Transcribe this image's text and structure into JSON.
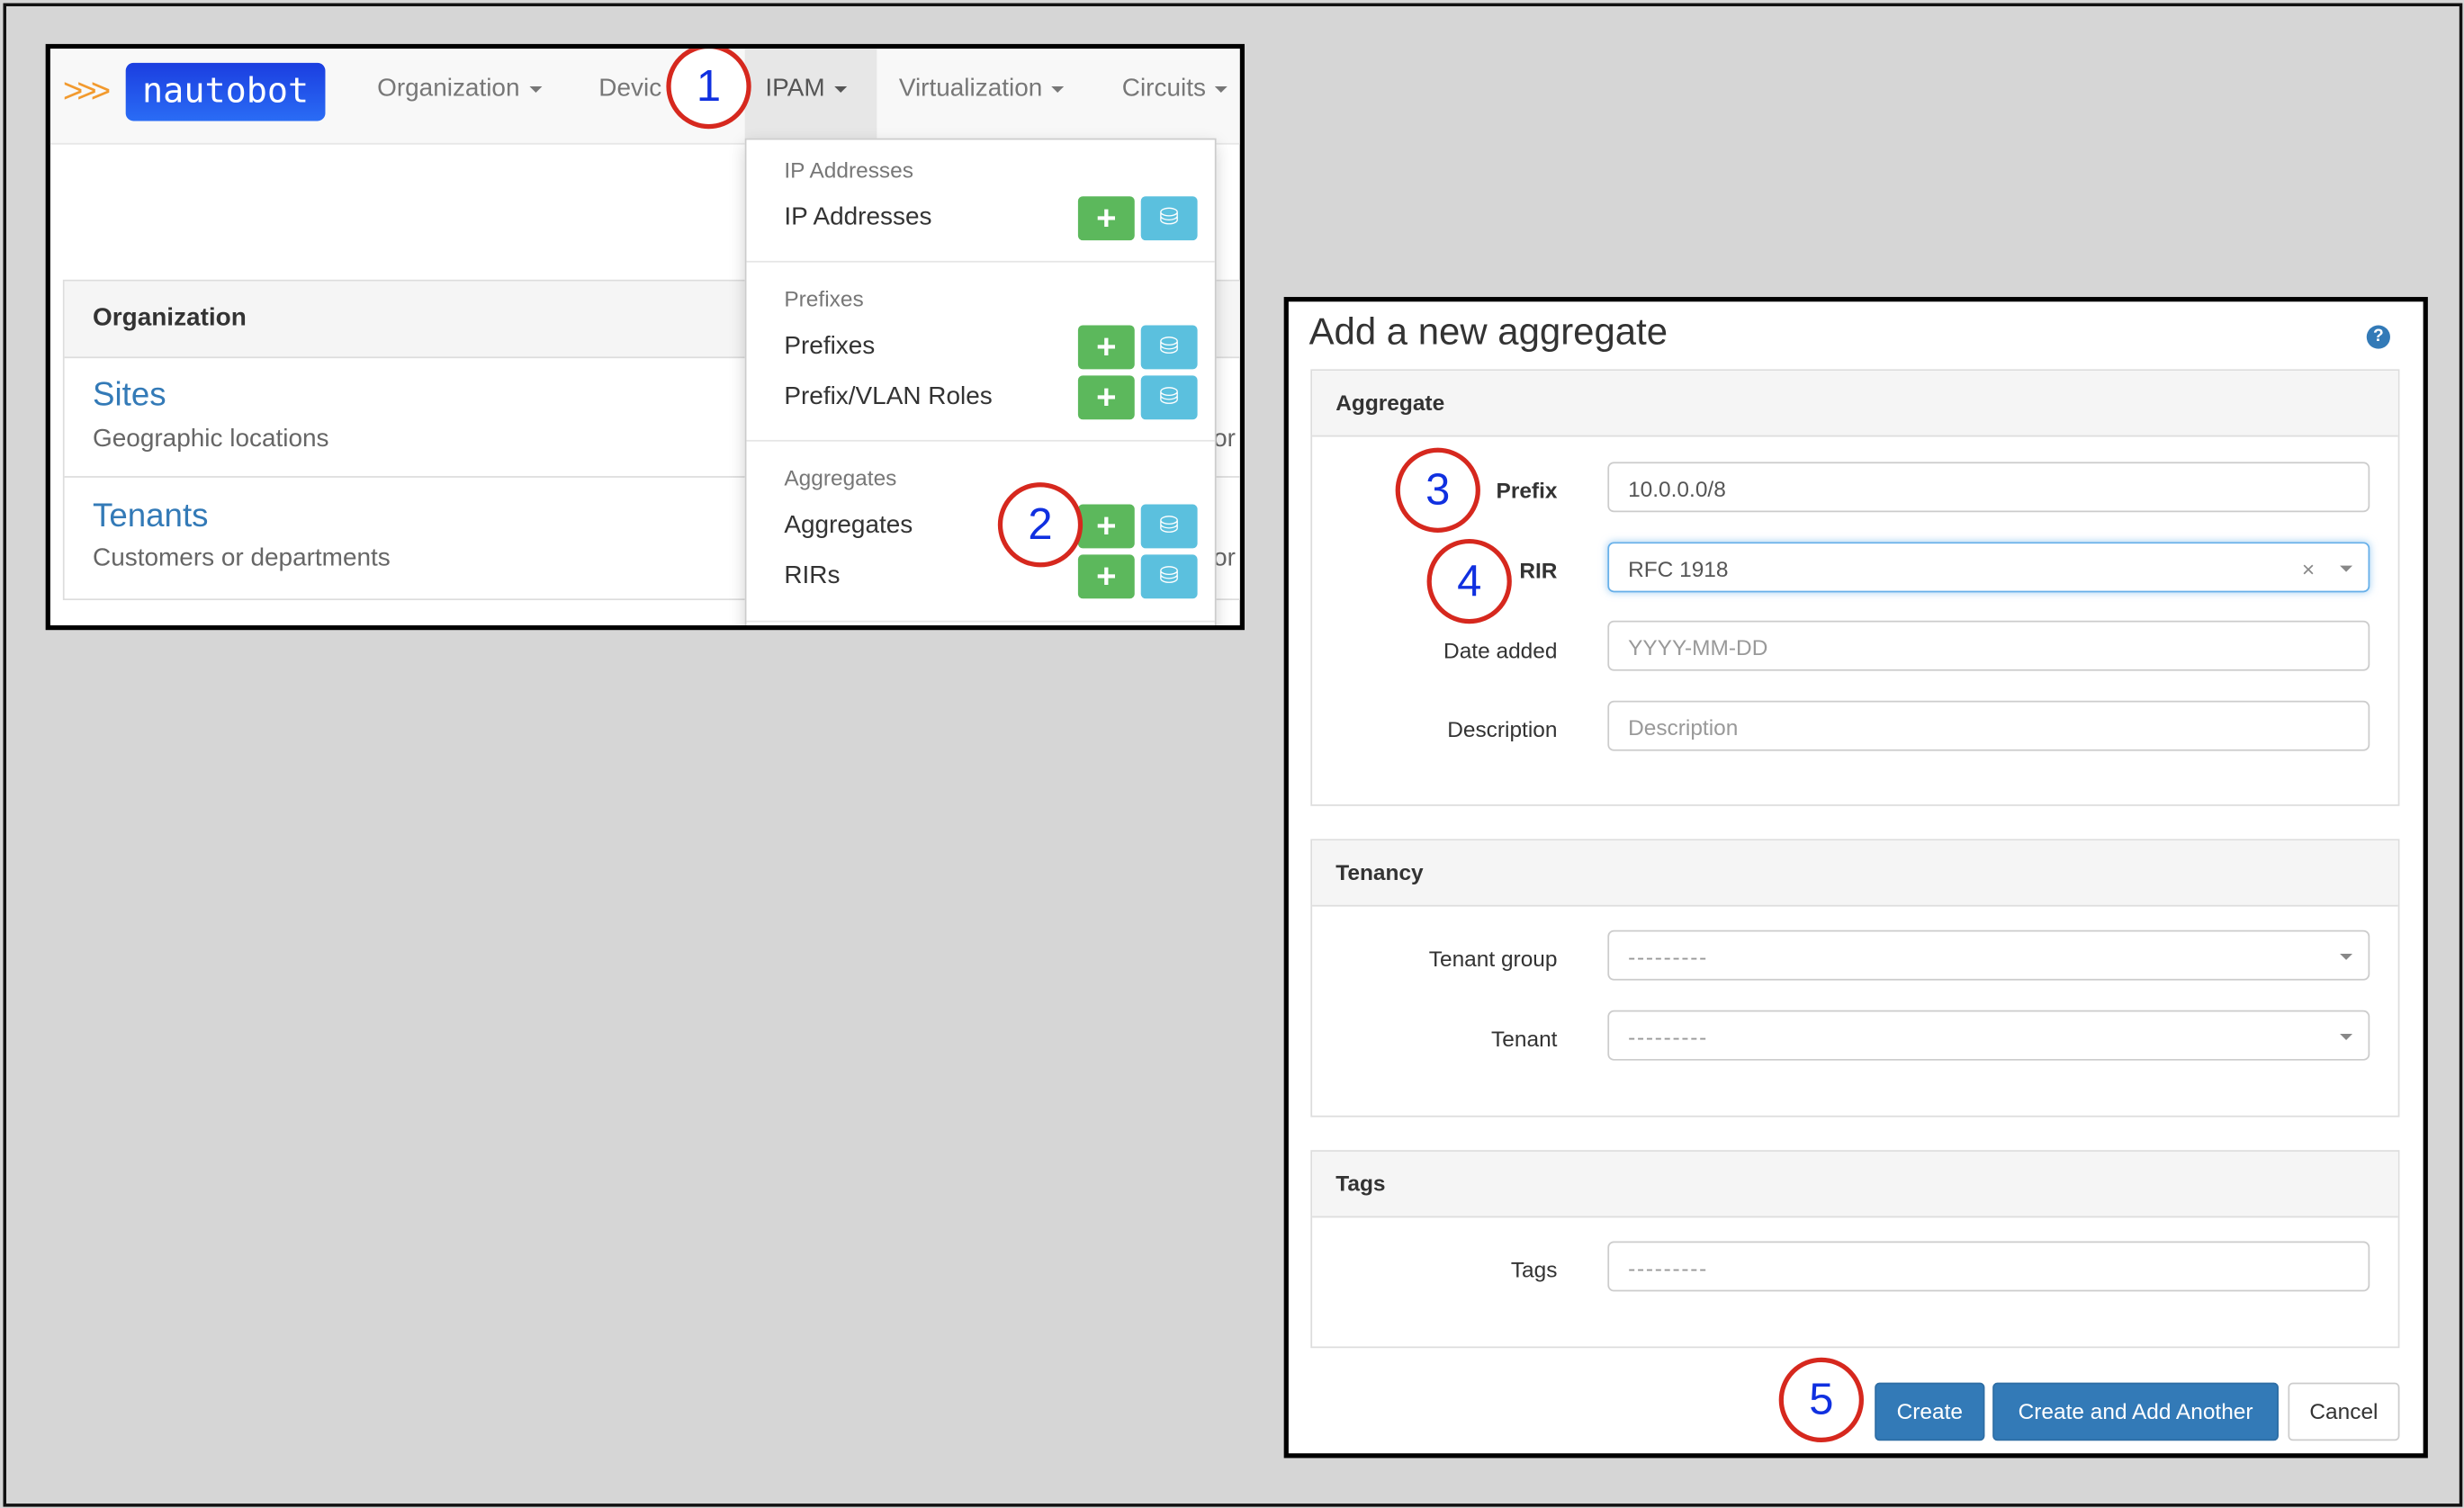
{
  "navbar": {
    "logo_text": "nautobot",
    "logo_chevrons": ">>>",
    "items": [
      {
        "label": "Organization"
      },
      {
        "label": "Devic"
      },
      {
        "label": "IPAM"
      },
      {
        "label": "Virtualization"
      },
      {
        "label": "Circuits"
      }
    ]
  },
  "ipam_menu": {
    "groups": [
      {
        "header": "IP Addresses",
        "items": [
          {
            "label": "IP Addresses"
          }
        ]
      },
      {
        "header": "Prefixes",
        "items": [
          {
            "label": "Prefixes"
          },
          {
            "label": "Prefix/VLAN Roles"
          }
        ]
      },
      {
        "header": "Aggregates",
        "items": [
          {
            "label": "Aggregates"
          },
          {
            "label": "RIRs"
          }
        ]
      }
    ],
    "add_icon": "plus-icon",
    "import_icon": "database-import-icon"
  },
  "home": {
    "panel_title": "Organization",
    "items": [
      {
        "title": "Sites",
        "description": "Geographic locations"
      },
      {
        "title": "Tenants",
        "description": "Customers or departments"
      }
    ],
    "clipped_text": "or"
  },
  "form": {
    "title": "Add a new aggregate",
    "help_icon": "question-circle-icon",
    "sections": {
      "aggregate": {
        "title": "Aggregate",
        "prefix_label": "Prefix",
        "prefix_value": "10.0.0.0/8",
        "rir_label": "RIR",
        "rir_value": "RFC 1918",
        "rir_clear": "×",
        "date_label": "Date added",
        "date_placeholder": "YYYY-MM-DD",
        "desc_label": "Description",
        "desc_placeholder": "Description"
      },
      "tenancy": {
        "title": "Tenancy",
        "tenant_group_label": "Tenant group",
        "tenant_group_value": "---------",
        "tenant_label": "Tenant",
        "tenant_value": "---------"
      },
      "tags": {
        "title": "Tags",
        "tags_label": "Tags",
        "tags_value": "---------"
      }
    },
    "buttons": {
      "create": "Create",
      "create_another": "Create and Add Another",
      "cancel": "Cancel"
    }
  },
  "annotations": [
    "1",
    "2",
    "3",
    "4",
    "5"
  ],
  "colors": {
    "annotation_ring": "#d6281e",
    "annotation_number": "#1030e0",
    "primary": "#337ab7",
    "add": "#5cb85c",
    "import": "#5bc0de",
    "link": "#337ab7"
  }
}
